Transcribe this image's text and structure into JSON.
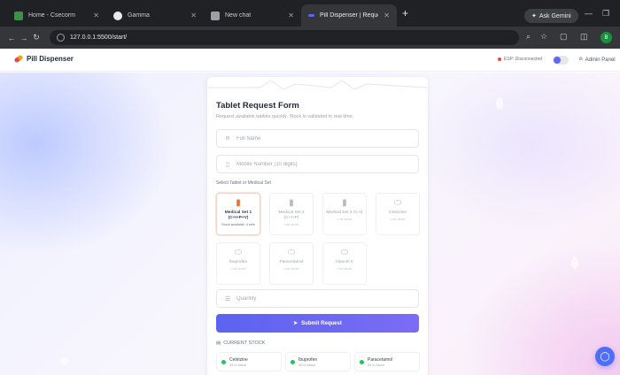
{
  "browser": {
    "tabs": [
      {
        "title": "Home - Csecorm",
        "color": "#3f8f4a"
      },
      {
        "title": "Gamma",
        "color": "#e8eaed"
      },
      {
        "title": "New chat",
        "color": "#9aa0a6"
      },
      {
        "title": "Pill Dispenser | Request Tablet",
        "color": "#5b63f0"
      }
    ],
    "new_tab": "+",
    "gemini_label": "Ask Gemini",
    "url": "127.0.0.1:5500/start/",
    "profile_initial": "B"
  },
  "app": {
    "brand": "Pill Dispenser",
    "status": "ESP: Disconnected",
    "admin_label": "Admin Panel"
  },
  "form": {
    "title": "Tablet Request Form",
    "subtitle": "Request available tablets quickly. Stock is validated in real time.",
    "name_placeholder": "Full Name",
    "mobile_placeholder": "Mobile Number (10 digits)",
    "section_label": "Select Tablet or Medical Set",
    "tiles": [
      {
        "name": "Medical Set 1 (C+I+P+V)",
        "stock": "Stock available: 4 sets",
        "icon": "box-icon",
        "selected": true
      },
      {
        "name": "Medical Set 2 (C+I+P)",
        "stock": "Low stock",
        "icon": "box-icon",
        "selected": false
      },
      {
        "name": "Medical Set 3 (C+I)",
        "stock": "Low stock",
        "icon": "box-icon",
        "selected": false
      },
      {
        "name": "Cetirizine",
        "stock": "Low stock",
        "icon": "pill-icon",
        "selected": false
      },
      {
        "name": "Ibuprofen",
        "stock": "Low stock",
        "icon": "pill-icon",
        "selected": false
      },
      {
        "name": "Paracetamol",
        "stock": "Low stock",
        "icon": "pill-icon",
        "selected": false
      },
      {
        "name": "Vitamin C",
        "stock": "Low stock",
        "icon": "pill-icon",
        "selected": false
      }
    ],
    "quantity_placeholder": "Quantity",
    "submit_label": "Submit Request",
    "stock_header": "CURRENT STOCK",
    "stock": [
      {
        "name": "Cetirizine",
        "count": "33 in stock"
      },
      {
        "name": "Ibuprofen",
        "count": "30 in stock"
      },
      {
        "name": "Paracetamol",
        "count": "33 in stock"
      }
    ]
  },
  "colors": {
    "accent": "#5b63f0",
    "status_dot": "#ef4444",
    "stock_dot": "#22c55e"
  }
}
